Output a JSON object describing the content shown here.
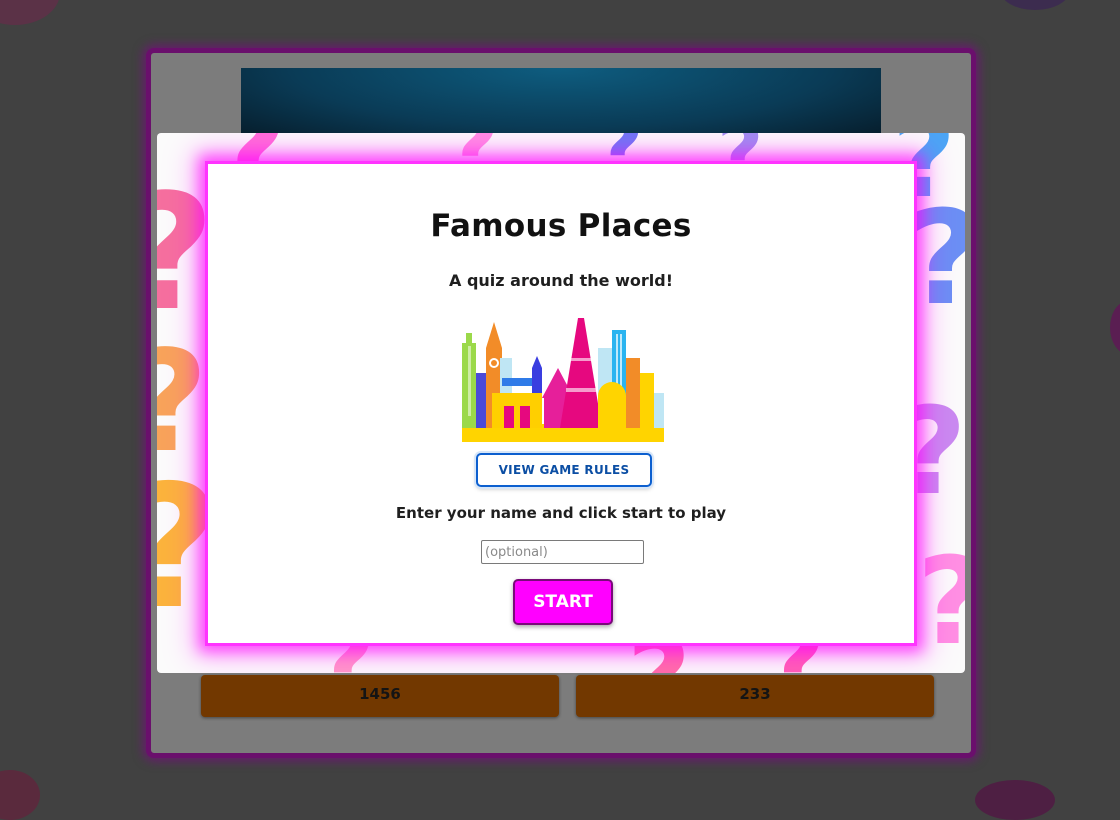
{
  "modal": {
    "title": "Famous Places",
    "subtitle": "A quiz around the world!",
    "rules_button_label": "VIEW GAME RULES",
    "name_prompt": "Enter your name and click start to play",
    "name_input": {
      "placeholder": "(optional)",
      "value": ""
    },
    "start_button_label": "START",
    "illustration": "world-landmarks-skyline-illustration"
  },
  "game": {
    "answer_tiles": [
      "1456",
      "233"
    ]
  },
  "colors": {
    "accent": "#ff00ff",
    "frame_border": "#6a0f6c",
    "rules_button_border": "#0c5fcf",
    "answer_tile": "#723800",
    "backdrop": "#414141"
  }
}
